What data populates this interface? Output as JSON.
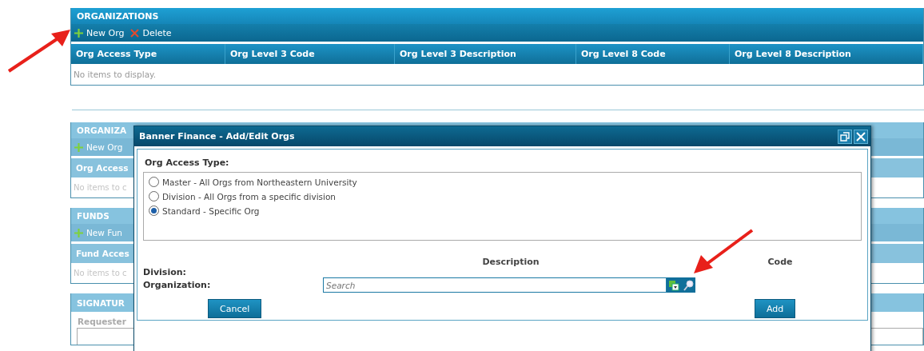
{
  "organizations": {
    "title": "ORGANIZATIONS",
    "toolbar": [
      {
        "kind": "add",
        "label": "New Org"
      },
      {
        "kind": "delete",
        "label": "Delete"
      }
    ],
    "columns": [
      "Org Access Type",
      "Org Level 3 Code",
      "Org Level 3 Description",
      "Org Level 8 Code",
      "Org Level 8 Description"
    ],
    "empty_text": "No items to display."
  },
  "background_sections": [
    {
      "title": "ORGANIZA",
      "toolbar": [
        {
          "kind": "add",
          "label": "New Org"
        }
      ],
      "column": "Org Access",
      "empty_text": "No items to c"
    },
    {
      "title": "FUNDS",
      "toolbar": [
        {
          "kind": "add",
          "label": "New Fun"
        }
      ],
      "column": "Fund Acces",
      "empty_text": "No items to c"
    }
  ],
  "signatures": {
    "title": "SIGNATUR",
    "label": "Requester"
  },
  "dialog": {
    "title": "Banner Finance - Add/Edit Orgs",
    "access_type_label": "Org Access Type:",
    "options": [
      {
        "label": "Master - All Orgs from Northeastern University",
        "selected": false
      },
      {
        "label": "Division - All Orgs from a specific division",
        "selected": false
      },
      {
        "label": "Standard - Specific Org",
        "selected": true
      }
    ],
    "column_headers": [
      "Description",
      "Code"
    ],
    "fields": [
      {
        "label": "Division:"
      },
      {
        "label": "Organization:",
        "placeholder": "Search"
      }
    ],
    "buttons": [
      "Cancel",
      "Add"
    ]
  }
}
